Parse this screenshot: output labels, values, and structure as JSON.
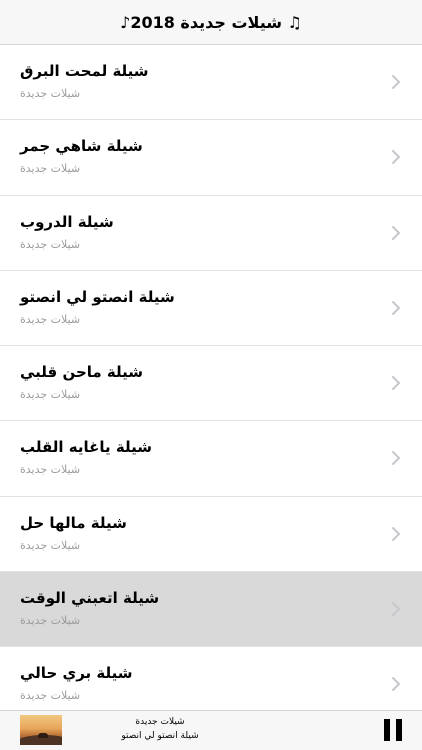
{
  "header": {
    "title": "♫ شيلات جديدة 2018♪"
  },
  "list": {
    "items": [
      {
        "title": "شيلة لمحت البرق",
        "subtitle": "شيلات جديدة",
        "selected": false
      },
      {
        "title": "شيلة شاهي جمر",
        "subtitle": "شيلات جديدة",
        "selected": false
      },
      {
        "title": "شيلة الدروب",
        "subtitle": "شيلات جديدة",
        "selected": false
      },
      {
        "title": "شيلة انصتو لي انصتو",
        "subtitle": "شيلات جديدة",
        "selected": false
      },
      {
        "title": "شيلة ماحن قلبي",
        "subtitle": "شيلات جديدة",
        "selected": false
      },
      {
        "title": "شيلة ياغايه القلب",
        "subtitle": "شيلات جديدة",
        "selected": false
      },
      {
        "title": "شيلة مالها حل",
        "subtitle": "شيلات جديدة",
        "selected": false
      },
      {
        "title": "شيلة اتعبني الوقت",
        "subtitle": "شيلات جديدة",
        "selected": true
      },
      {
        "title": "شيلة بري حالي",
        "subtitle": "شيلات جديدة",
        "selected": false
      }
    ],
    "chevron_icon": "chevron-right-icon"
  },
  "player": {
    "album": "شيلات جديدة",
    "track": "شيلة انصتو لي انصتو",
    "artwork_icon": "desert-sunset-artwork",
    "control_icon": "pause-icon"
  },
  "colors": {
    "bar_background": "#f7f7f7",
    "selected_row": "#d9d9d9",
    "subtitle": "#9b9b9b",
    "chevron": "#c7c7cc"
  }
}
